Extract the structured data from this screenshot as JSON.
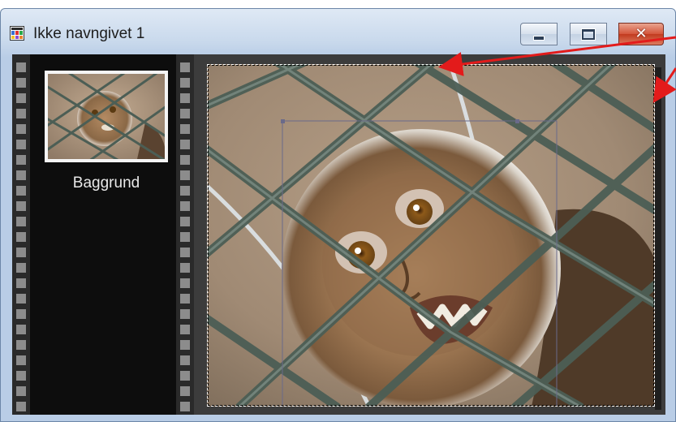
{
  "window": {
    "title": "Ikke navngivet 1",
    "controls": {
      "close_glyph": "✕"
    }
  },
  "layers_panel": {
    "layers": [
      {
        "label": "Baggrund",
        "selected": true
      }
    ]
  },
  "colors": {
    "annotation_arrow": "#e31b1b",
    "fence_wire": "#4c5e55",
    "close_button": "#d4553a"
  },
  "icons": [
    "app-icon",
    "minimize-icon",
    "maximize-icon",
    "close-icon"
  ]
}
